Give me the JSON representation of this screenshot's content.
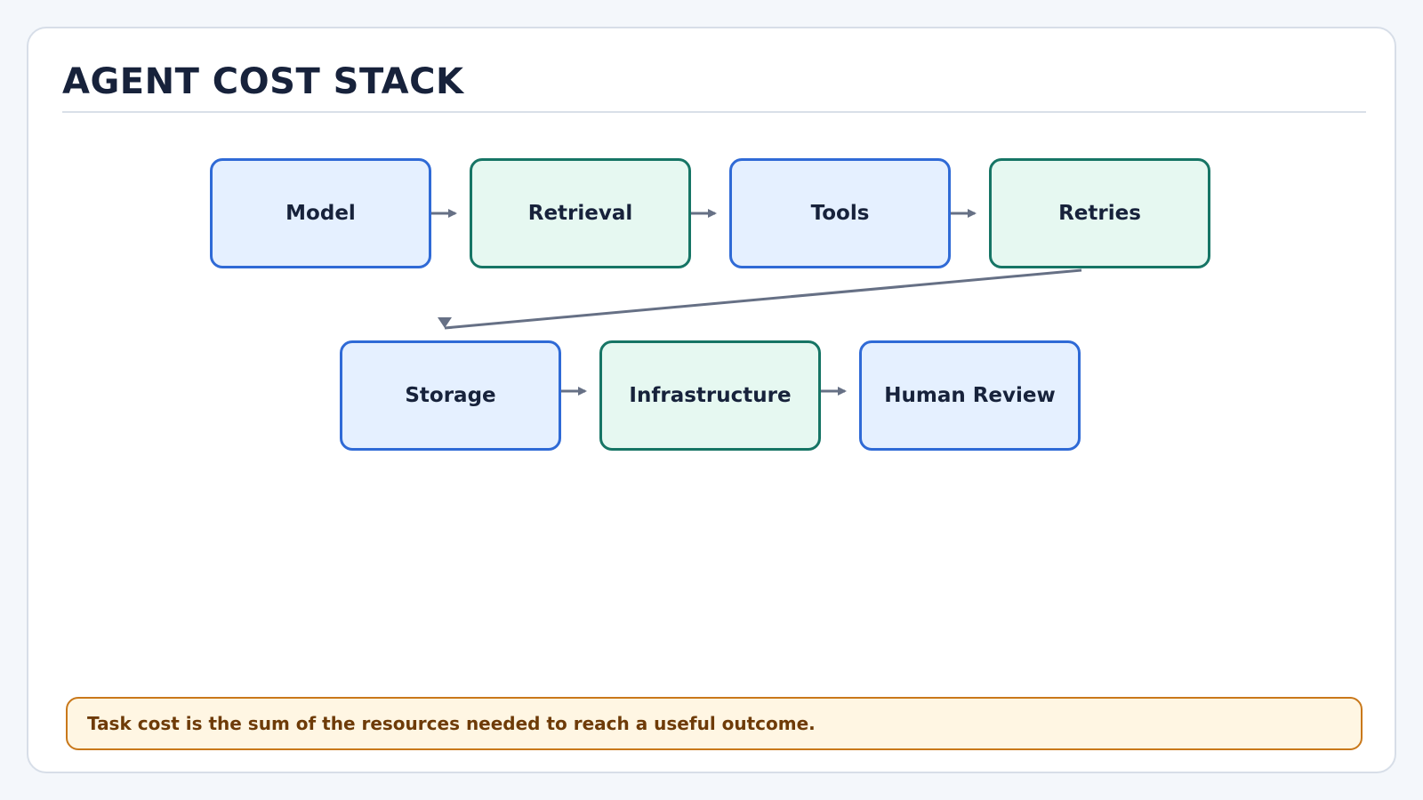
{
  "title": "AGENT COST STACK",
  "nodes": [
    {
      "id": "model",
      "label": "Model",
      "accent": "blue"
    },
    {
      "id": "retrieval",
      "label": "Retrieval",
      "accent": "green"
    },
    {
      "id": "tools",
      "label": "Tools",
      "accent": "blue"
    },
    {
      "id": "retries",
      "label": "Retries",
      "accent": "green"
    },
    {
      "id": "storage",
      "label": "Storage",
      "accent": "blue"
    },
    {
      "id": "infrastructure",
      "label": "Infrastructure",
      "accent": "green"
    },
    {
      "id": "human_review",
      "label": "Human Review",
      "accent": "blue"
    }
  ],
  "edges": [
    {
      "from": "model",
      "to": "retrieval"
    },
    {
      "from": "retrieval",
      "to": "tools"
    },
    {
      "from": "tools",
      "to": "retries"
    },
    {
      "from": "retries",
      "to": "storage"
    },
    {
      "from": "storage",
      "to": "infrastructure"
    },
    {
      "from": "infrastructure",
      "to": "human_review"
    }
  ],
  "note": "Task cost is the sum of the resources needed to reach a useful outcome.",
  "colors": {
    "background": "#f4f7fb",
    "card": "#ffffff",
    "title": "#17223b",
    "blue_border": "#2f6ad6",
    "blue_fill": "#e5f0ff",
    "green_border": "#167565",
    "green_fill": "#e6f8f1",
    "arrow": "#667085",
    "note_border": "#c9781a",
    "note_fill": "#fff6e3",
    "note_text": "#6e3b08"
  }
}
